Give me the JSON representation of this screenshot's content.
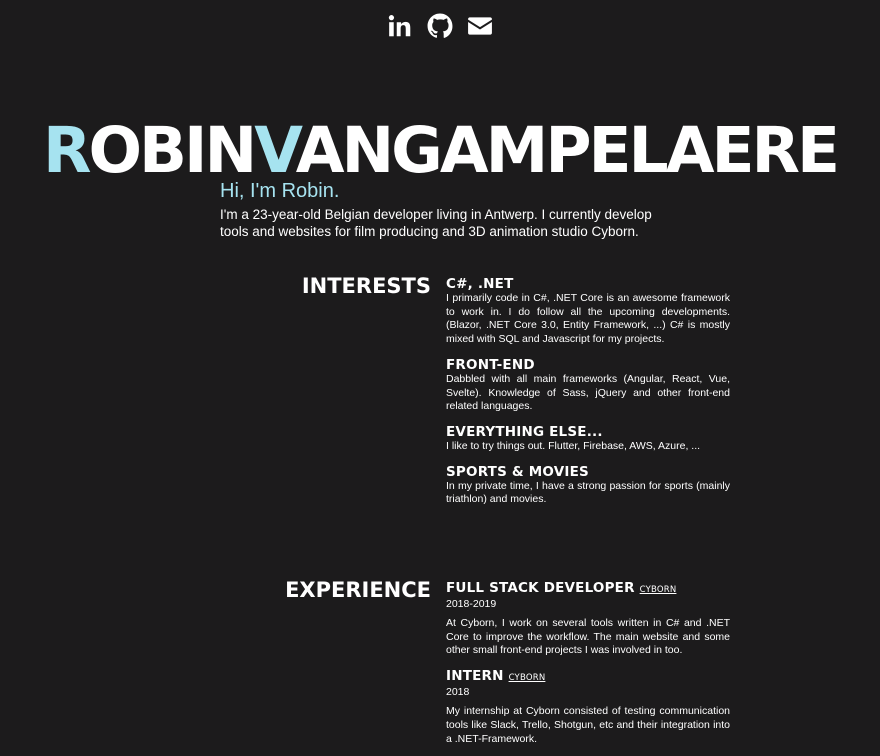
{
  "social": {
    "icons": [
      "linkedin-icon",
      "github-icon",
      "envelope-icon"
    ]
  },
  "header": {
    "name_first_initial": "R",
    "name_first_rest": "OBIN",
    "name_last_initial": "V",
    "name_last_rest": "ANGAMPELAERE",
    "accent_color": "#a6e3f0"
  },
  "intro": {
    "greeting": "Hi, I'm Robin.",
    "bio": "I'm a 23-year-old Belgian developer living in Antwerp. I currently develop tools and websites for film producing and 3D animation studio Cyborn."
  },
  "interests": {
    "title": "INTERESTS",
    "items": [
      {
        "heading": "C#, .NET",
        "text": "I primarily code in C#, .NET Core is an awesome framework to work in. I do follow all the upcoming developments. (Blazor, .NET Core 3.0, Entity Framework, ...) C# is mostly mixed with SQL and Javascript for my projects."
      },
      {
        "heading": "FRONT-END",
        "text": "Dabbled with all main frameworks (Angular, React, Vue, Svelte). Knowledge of Sass, jQuery and other front-end related languages."
      },
      {
        "heading": "EVERYTHING ELSE...",
        "text": "I like to try things out. Flutter, Firebase, AWS, Azure, ..."
      },
      {
        "heading": "SPORTS & MOVIES",
        "text": "In my private time, I have a strong passion for sports (mainly triathlon) and movies."
      }
    ]
  },
  "experience": {
    "title": "EXPERIENCE",
    "items": [
      {
        "heading": "FULL STACK DEVELOPER",
        "company": "CYBORN",
        "years": "2018-2019",
        "text": "At Cyborn, I work on several tools written in C# and .NET Core to improve the workflow. The main website and some other small front-end projects I was involved in too."
      },
      {
        "heading": "INTERN",
        "company": "CYBORN",
        "years": "2018",
        "text": "My internship at Cyborn consisted of testing communication tools like Slack, Trello, Shotgun, etc and their integration into a .NET-Framework."
      }
    ]
  }
}
